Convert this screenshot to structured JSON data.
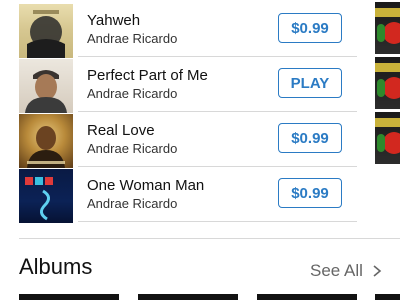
{
  "songs": [
    {
      "title": "Yahweh",
      "artist": "Andrae Ricardo",
      "action": "$0.99"
    },
    {
      "title": "Perfect Part of Me",
      "artist": "Andrae Ricardo",
      "action": "PLAY"
    },
    {
      "title": "Real Love",
      "artist": "Andrae Ricardo",
      "action": "$0.99"
    },
    {
      "title": "One Woman Man",
      "artist": "Andrae Ricardo",
      "action": "$0.99"
    }
  ],
  "albums": {
    "title": "Albums",
    "see_all": "See All"
  },
  "colors": {
    "accent": "#2b7bc4",
    "separator": "#d8d8d8"
  }
}
